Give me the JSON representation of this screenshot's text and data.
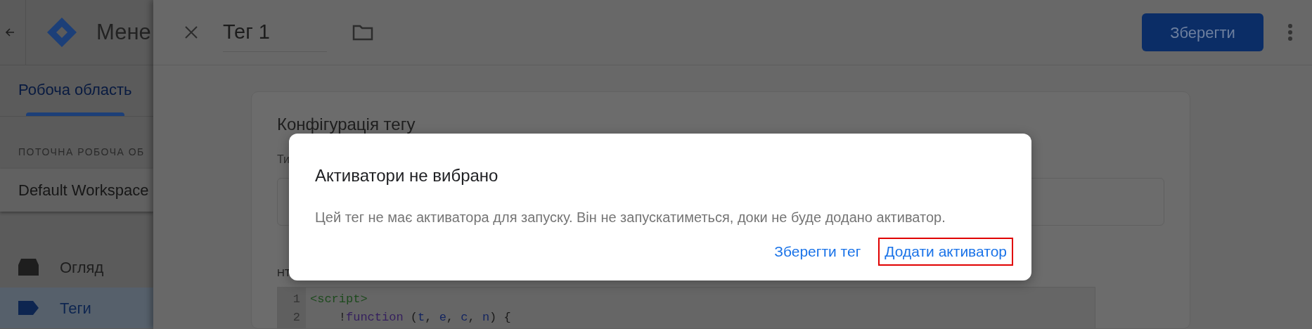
{
  "sidebar": {
    "app_title": "Мене",
    "tabs": [
      {
        "label": "Робоча область",
        "selected": true
      }
    ],
    "workspace": {
      "label": "ПОТОЧНА РОБОЧА ОБ",
      "value": "Default Workspace"
    },
    "nav": [
      {
        "label": "Огляд",
        "kind": "overview",
        "selected": false
      },
      {
        "label": "Теги",
        "kind": "tag",
        "selected": true
      }
    ]
  },
  "header": {
    "tag_name": "Тег 1",
    "save_button": "Зберегти"
  },
  "card": {
    "title": "Конфігурація тегу",
    "type_label": "Ти",
    "html_label": "HT",
    "code_lines": [
      {
        "number": "1",
        "tokens": [
          {
            "text": "<script>",
            "kind": "tag"
          }
        ]
      },
      {
        "number": "2",
        "tokens": [
          {
            "text": "    !",
            "kind": "plain"
          },
          {
            "text": "function",
            "kind": "keyword"
          },
          {
            "text": " (",
            "kind": "plain"
          },
          {
            "text": "t",
            "kind": "var"
          },
          {
            "text": ", ",
            "kind": "plain"
          },
          {
            "text": "e",
            "kind": "var"
          },
          {
            "text": ", ",
            "kind": "plain"
          },
          {
            "text": "c",
            "kind": "var"
          },
          {
            "text": ", ",
            "kind": "plain"
          },
          {
            "text": "n",
            "kind": "var"
          },
          {
            "text": ") {",
            "kind": "plain"
          }
        ]
      }
    ]
  },
  "dialog": {
    "title": "Активатори не вибрано",
    "message": "Цей тег не має активатора для запуску. Він не запускатиметься, доки не буде додано активатор.",
    "buttons": [
      {
        "label": "Зберегти тег",
        "highlighted": false
      },
      {
        "label": "Додати активатор",
        "highlighted": true
      }
    ]
  }
}
